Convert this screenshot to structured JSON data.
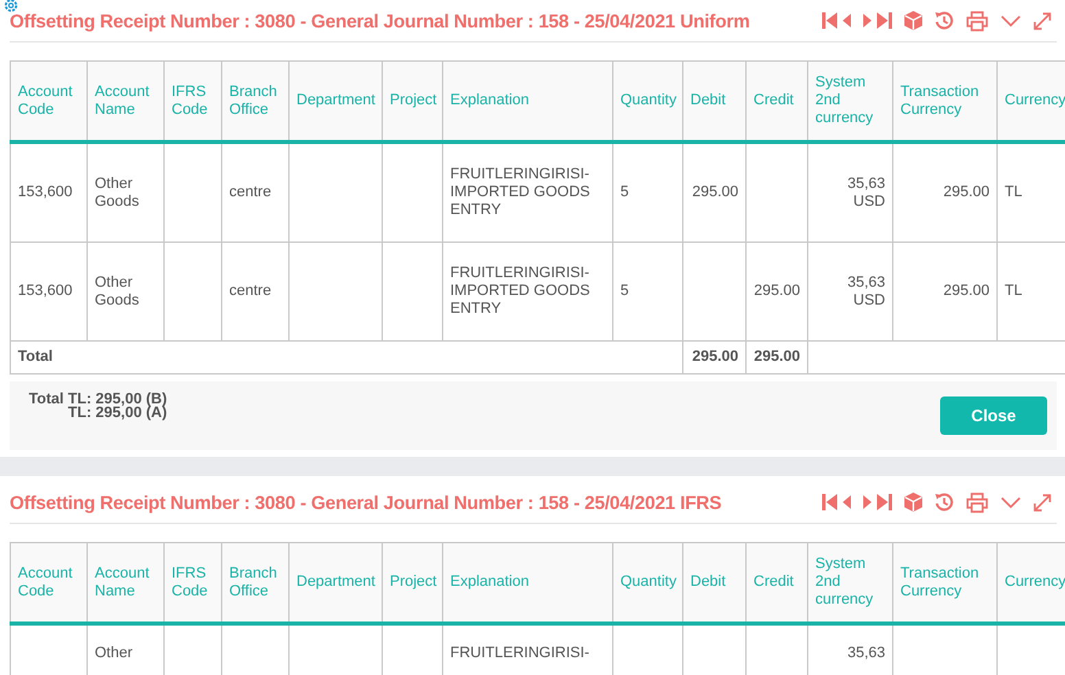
{
  "panels": [
    {
      "title": "Offsetting Receipt Number : 3080 - General Journal Number : 158 - 25/04/2021 Uniform",
      "columns": [
        "Account Code",
        "Account Name",
        "IFRS Code",
        "Branch Office",
        "Department",
        "Project",
        "Explanation",
        "Quantity",
        "Debit",
        "Credit",
        "System 2nd currency",
        "Transaction Currency",
        "Currency"
      ],
      "rows": [
        {
          "cells": [
            "153,600",
            "Other Goods",
            null,
            "centre",
            null,
            null,
            "FRUITLERINGIRISI-IMPORTED GOODS ENTRY",
            "5",
            "295.00",
            null,
            "35,63 USD",
            "295.00",
            "TL"
          ]
        },
        {
          "cells": [
            "153,600",
            "Other Goods",
            null,
            "centre",
            null,
            null,
            "FRUITLERINGIRISI-IMPORTED GOODS ENTRY",
            "5",
            null,
            "295.00",
            "35,63 USD",
            "295.00",
            "TL"
          ]
        }
      ],
      "total": {
        "label": "Total",
        "debit": "295.00",
        "credit": "295.00"
      },
      "footer": {
        "lines": [
          "Total TL: 295,00 (B)",
          "TL: 295,00 (A)"
        ],
        "button": "Close"
      }
    },
    {
      "title": "Offsetting Receipt Number : 3080 - General Journal Number : 158 - 25/04/2021 IFRS",
      "columns": [
        "Account Code",
        "Account Name",
        "IFRS Code",
        "Branch Office",
        "Department",
        "Project",
        "Explanation",
        "Quantity",
        "Debit",
        "Credit",
        "System 2nd currency",
        "Transaction Currency",
        "Currency"
      ],
      "rows": [
        {
          "cells": [
            null,
            "Other",
            null,
            null,
            null,
            null,
            "FRUITLERINGIRISI-",
            null,
            null,
            null,
            "35,63",
            null,
            null
          ]
        }
      ]
    }
  ]
}
